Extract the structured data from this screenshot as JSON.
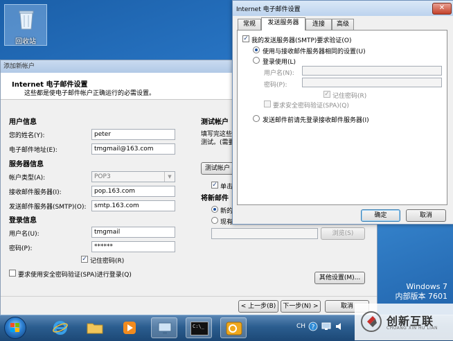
{
  "desktop": {
    "recycle_bin_label": "回收站",
    "os_name": "Windows 7",
    "build_text": "内部版本 7601"
  },
  "wizard": {
    "window_title": "添加新帐户",
    "header_title": "Internet 电子邮件设置",
    "header_subtitle": "这些都是使电子邮件帐户正确运行的必需设置。",
    "user_info_title": "用户信息",
    "name_label": "您的姓名(Y):",
    "name_value": "peter",
    "email_label": "电子邮件地址(E):",
    "email_value": "tmgmail@163.com",
    "server_info_title": "服务器信息",
    "account_type_label": "帐户类型(A):",
    "account_type_value": "POP3",
    "incoming_label": "接收邮件服务器(I):",
    "incoming_value": "pop.163.com",
    "outgoing_label": "发送邮件服务器(SMTP)(O):",
    "outgoing_value": "smtp.163.com",
    "login_info_title": "登录信息",
    "username_label": "用户名(U):",
    "username_value": "tmgmail",
    "password_label": "密码(P):",
    "password_value": "******",
    "remember_password_label": "记住密码(R)",
    "spa_label": "要求使用安全密码验证(SPA)进行登录(Q)",
    "test_title": "测试帐户",
    "test_desc_line1": "填写完这些",
    "test_desc_line2": "测试。(需要",
    "test_button": "测试帐户",
    "single_label": "单击",
    "deliver_title": "将新邮件",
    "radio_new_label": "新的",
    "radio_existing_label": "现有",
    "browse_button": "浏览(S)",
    "more_settings_button": "其他设置(M)...",
    "back_button": "< 上一步(B)",
    "next_button": "下一步(N) >",
    "cancel_button": "取消"
  },
  "dialog": {
    "title": "Internet 电子邮件设置",
    "close_glyph": "✕",
    "tabs": [
      {
        "label": "常规"
      },
      {
        "label": "发送服务器"
      },
      {
        "label": "连接"
      },
      {
        "label": "高级"
      }
    ],
    "smtp_auth_label": "我的发送服务器(SMTP)要求验证(O)",
    "same_settings_label": "使用与接收邮件服务器相同的设置(U)",
    "login_using_label": "登录使用(L)",
    "username_label": "用户名(N):",
    "password_label": "密码(P):",
    "remember_password_label": "记住密码(R)",
    "spa_label": "要求安全密码验证(SPA)(Q)",
    "login_pop_first_label": "发送邮件前请先登录接收邮件服务器(I)",
    "ok_button": "确定",
    "cancel_button": "取消"
  },
  "taskbar": {
    "lang": "CH",
    "watermark_text": "创新互联",
    "watermark_sub": "CHUANG XIN HU LIAN",
    "cmd_icon_text": "C:\\_"
  },
  "check_glyph": "✓"
}
